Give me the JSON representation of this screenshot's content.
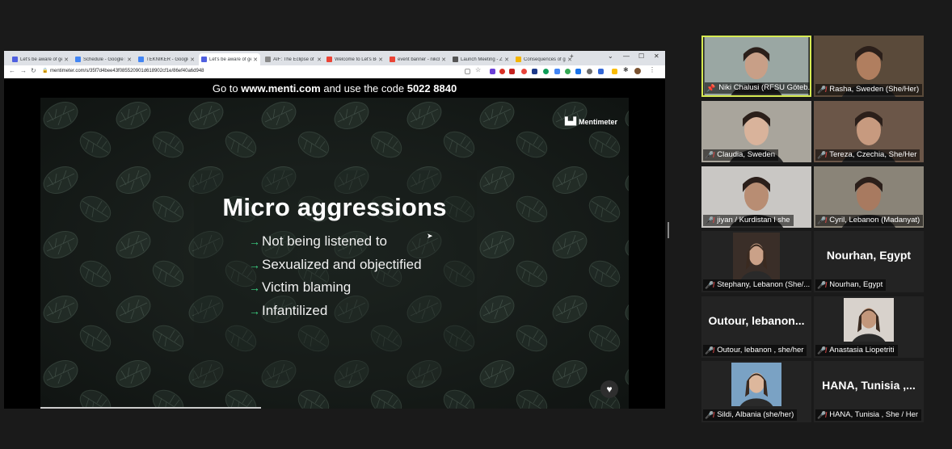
{
  "browser": {
    "tabs": [
      {
        "label": "Let's be aware of ge",
        "active": false,
        "favicon_color": "#4f5fe0"
      },
      {
        "label": "Schedule - Google D",
        "active": false,
        "favicon_color": "#4285f4"
      },
      {
        "label": "TEKNIKER - Google D",
        "active": false,
        "favicon_color": "#4285f4"
      },
      {
        "label": "Let's be aware of ge",
        "active": true,
        "favicon_color": "#4f5fe0"
      },
      {
        "label": "AIF: The Eclipse of th",
        "active": false,
        "favicon_color": "#888888"
      },
      {
        "label": "Welcome to Let's Be",
        "active": false,
        "favicon_color": "#ea4335"
      },
      {
        "label": "event banner - nikch",
        "active": false,
        "favicon_color": "#ea4335"
      },
      {
        "label": "Launch Meeting - Zo",
        "active": false,
        "favicon_color": "#555555"
      },
      {
        "label": "Consequences of ge",
        "active": false,
        "favicon_color": "#f4b400"
      }
    ],
    "new_tab": "+",
    "url": "mentimeter.com/s/35f7d4bee43f085520901d618902cf1e/86ef40a6d948"
  },
  "presentation": {
    "code_prefix": "Go to ",
    "site": "www.menti.com",
    "code_mid": " and use the code ",
    "code": "5022 8840",
    "brand": "Mentimeter",
    "title": "Micro aggressions",
    "bullets": [
      "Not being listened to",
      "Sexualized and objectified",
      "Victim blaming",
      "Infantilized"
    ],
    "bullet_arrow": "→",
    "heart": "♥"
  },
  "participants": [
    {
      "name": "Niki Chalusi (RFSU Göteb...",
      "type": "video",
      "active": true,
      "muted": false
    },
    {
      "name": "Rasha, Sweden (She/Her)",
      "type": "video",
      "muted": true
    },
    {
      "name": "Claudia, Sweden",
      "type": "video",
      "muted": true
    },
    {
      "name": "Tereza, Czechia, She/Her",
      "type": "video",
      "muted": true
    },
    {
      "name": "jiyan / Kurdistan l she",
      "type": "video",
      "muted": true
    },
    {
      "name": "Cyril, Lebanon (Madanyat)",
      "type": "video",
      "muted": true
    },
    {
      "name": "Stephany, Lebanon (She/...",
      "type": "photo",
      "muted": true
    },
    {
      "name": "Nourhan, Egypt",
      "type": "text",
      "display": "Nourhan, Egypt",
      "muted": true
    },
    {
      "name": "Outour, lebanon , she/her",
      "type": "text",
      "display": "Outour,  lebanon...",
      "muted": true
    },
    {
      "name": "Anastasia Liopetriti",
      "type": "photo",
      "muted": true
    },
    {
      "name": "Sildi, Albania (she/her)",
      "type": "photo",
      "muted": true
    },
    {
      "name": "HANA, Tunisia , She / Her",
      "type": "text",
      "display": "HANA,  Tunisia ,...",
      "muted": true
    }
  ]
}
